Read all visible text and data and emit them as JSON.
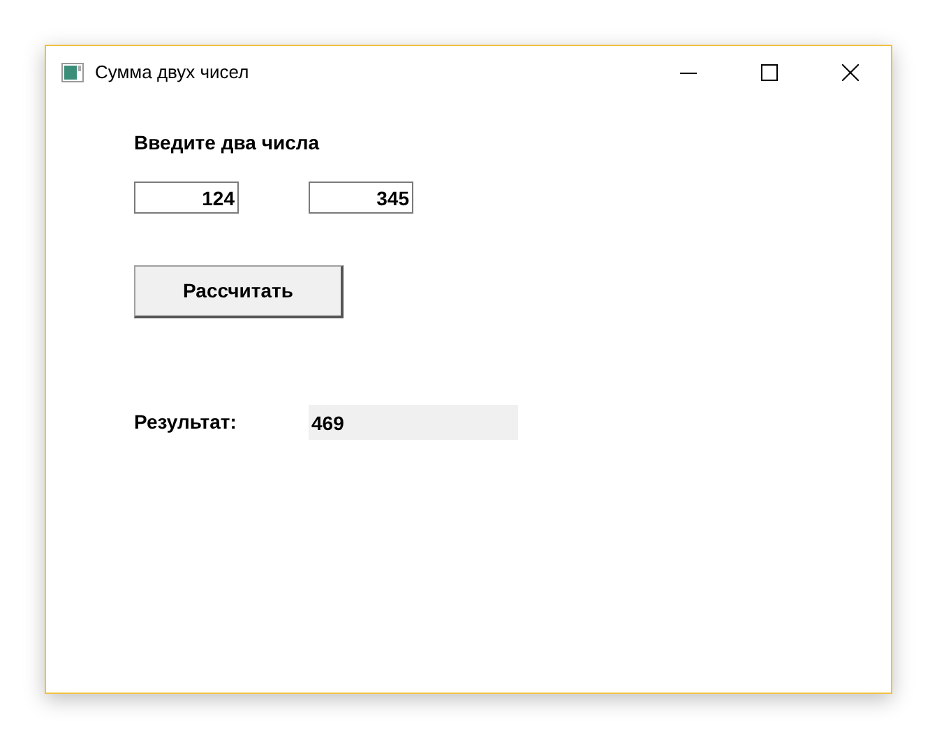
{
  "window": {
    "title": "Сумма двух чисел"
  },
  "prompt": "Введите два числа",
  "inputs": [
    {
      "value": "124"
    },
    {
      "value": "345"
    }
  ],
  "button": "Рассчитать",
  "result": {
    "label": "Результат:",
    "value": "469"
  }
}
